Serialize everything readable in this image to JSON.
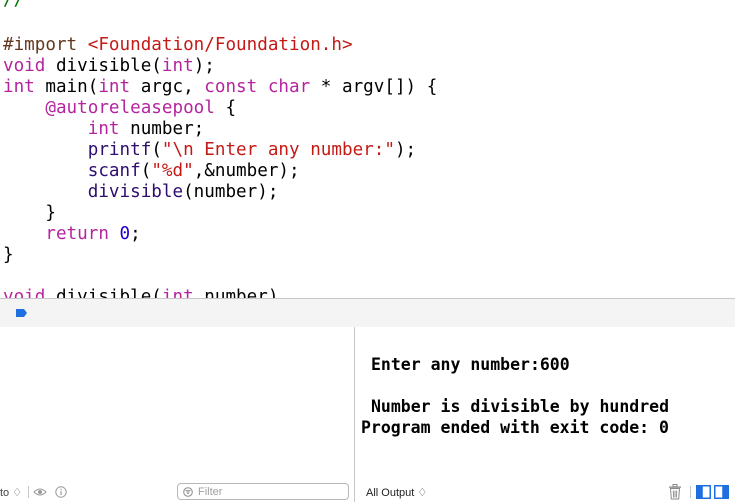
{
  "editor": {
    "lines": {
      "l0": {
        "comment": "//"
      },
      "l1": {
        "directive": "#import",
        "path": "<Foundation/Foundation.h>"
      },
      "l2": {
        "t1": "void",
        "t2": " divisible(",
        "t3": "int",
        "t4": ");"
      },
      "l3": {
        "t1": "int",
        "t2": " main(",
        "t3": "int",
        "t4": " argc, ",
        "t5": "const",
        "t6": " ",
        "t7": "char",
        "t8": " * argv[]) {"
      },
      "l4": {
        "t1": "    ",
        "t2": "@autoreleasepool",
        "t3": " {"
      },
      "l5": {
        "t1": "        ",
        "t2": "int",
        "t3": " number;"
      },
      "l6": {
        "t1": "        ",
        "t2": "printf",
        "t3": "(",
        "t4": "\"\\n Enter any number:\"",
        "t5": ");"
      },
      "l7": {
        "t1": "        ",
        "t2": "scanf",
        "t3": "(",
        "t4": "\"%d\"",
        "t5": ",&number);"
      },
      "l8": {
        "t1": "        ",
        "t2": "divisible",
        "t3": "(number);"
      },
      "l9": {
        "t1": "    }"
      },
      "l10": {
        "t1": "    ",
        "t2": "return",
        "t3": " ",
        "t4": "0",
        "t5": ";"
      },
      "l11": {
        "t1": "}"
      },
      "l12": {
        "t1": "void",
        "t2": " divisible(",
        "t3": "int",
        "t4": " number)"
      }
    }
  },
  "console": {
    "line1": "Enter any number:600",
    "line2": "Number is divisible by hundred",
    "line3": "Program ended with exit code: 0"
  },
  "bottom_bar": {
    "auto_label": "to ♢",
    "filter_placeholder": "Filter",
    "output_label": "All Output ♢"
  },
  "icons": {
    "breakpoint": "breakpoint-toggle-icon",
    "eye": "eye-icon",
    "info": "info-icon",
    "filter": "filter-icon",
    "trash": "trash-icon",
    "split_left": "split-left-icon",
    "split_right": "split-right-icon"
  },
  "colors": {
    "keyword": "#b5249f",
    "string": "#c41a16",
    "number": "#1c00cf",
    "function": "#2e0d6e",
    "preprocessor": "#643820",
    "accent": "#1e6fe0"
  }
}
